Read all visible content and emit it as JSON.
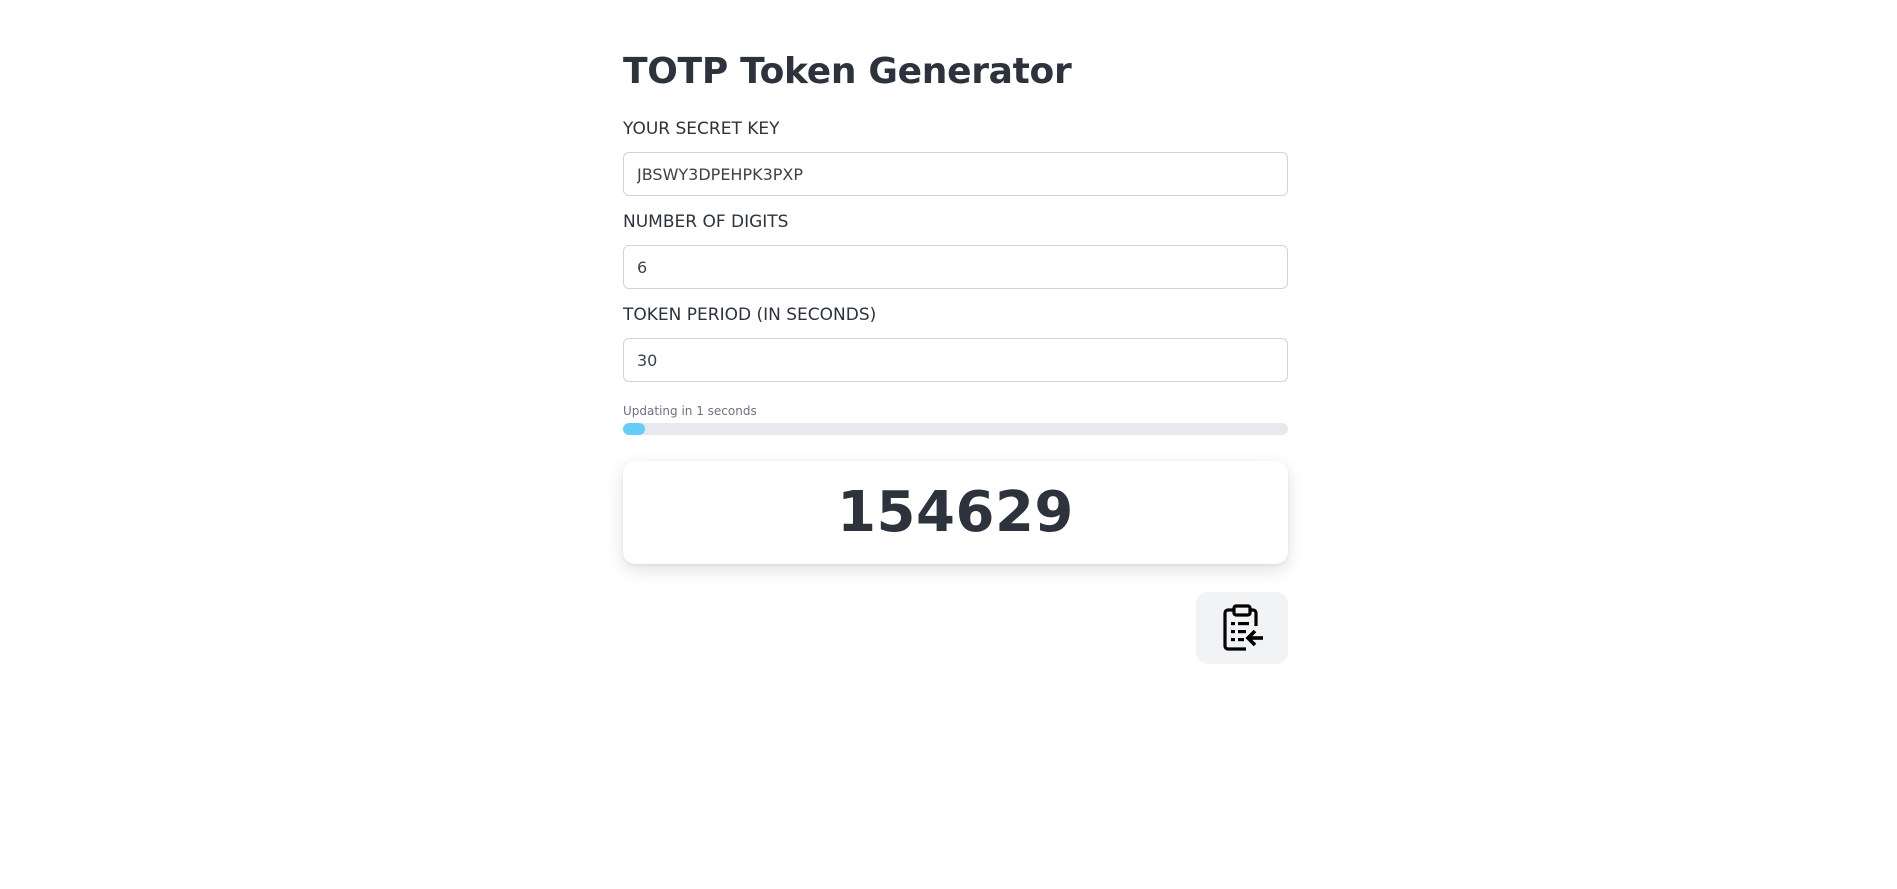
{
  "page": {
    "title": "TOTP Token Generator"
  },
  "form": {
    "secret": {
      "label": "YOUR SECRET KEY",
      "value": "JBSWY3DPEHPK3PXP"
    },
    "digits": {
      "label": "NUMBER OF DIGITS",
      "value": "6"
    },
    "period": {
      "label": "TOKEN PERIOD (IN SECONDS)",
      "value": "30"
    }
  },
  "countdown": {
    "text": "Updating in 1 seconds",
    "progress_fraction": 0.033,
    "fill_color": "#66ccf8",
    "track_color": "#e8e9ee"
  },
  "token": {
    "value": "154629"
  },
  "actions": {
    "copy_icon": "clipboard-copy-icon"
  }
}
